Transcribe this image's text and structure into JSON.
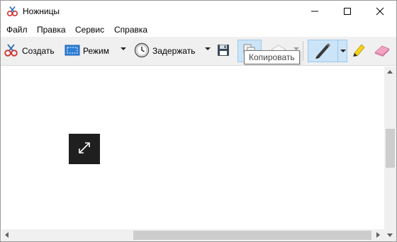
{
  "window": {
    "title": "Ножницы",
    "controls": {
      "minimize": "minimize",
      "maximize": "maximize",
      "close": "close"
    }
  },
  "menu": {
    "items": [
      {
        "label": "Файл",
        "underline": "Ф"
      },
      {
        "label": "Правка",
        "underline": "П"
      },
      {
        "label": "Сервис",
        "underline": "С"
      },
      {
        "label": "Справка",
        "underline": "С"
      }
    ]
  },
  "toolbar": {
    "create_label": "Создать",
    "mode_label": "Режим",
    "delay_label": "Задержать",
    "save_icon": "floppy-disk-icon",
    "copy_icon": "copy-icon",
    "eraser_icon": "eraser-icon",
    "pen_icon": "pen-icon",
    "highlighter_icon": "highlighter-icon",
    "tooltip": "Копировать"
  },
  "colors": {
    "toolbar_bg": "#f0f0f0",
    "selected_bg": "#cce4f7",
    "selected_border": "#99c9ef",
    "expand_box": "#1f1f1f",
    "highlighter": "#f5d21b",
    "eraser": "#f2a3c4"
  },
  "canvas": {
    "expand_icon": "expand-arrows-icon"
  }
}
